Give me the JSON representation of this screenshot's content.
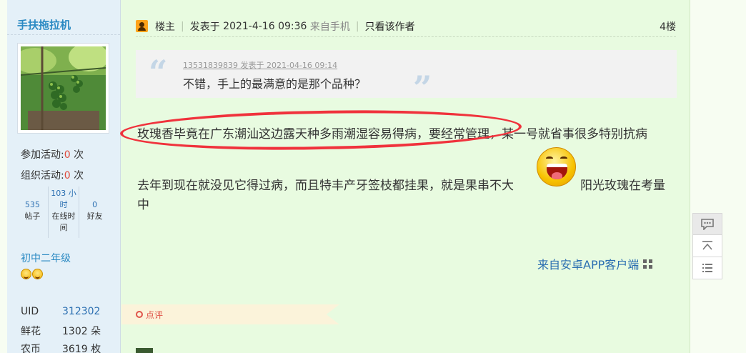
{
  "user": {
    "name": "手扶拖拉机",
    "activities": [
      {
        "label": "参加活动:",
        "value": "0",
        "unit": "次"
      },
      {
        "label": "组织活动:",
        "value": "0",
        "unit": "次"
      }
    ],
    "stats": [
      {
        "value": "535",
        "label": "帖子"
      },
      {
        "value": "103 小时",
        "label": "在线时间"
      },
      {
        "value": "0",
        "label": "好友"
      }
    ],
    "level": "初中二年级",
    "info": [
      {
        "key": "UID",
        "value": "312302"
      },
      {
        "key": "鲜花",
        "value": "1302 朵"
      },
      {
        "key": "农币",
        "value": "3619 枚"
      }
    ]
  },
  "post": {
    "role": "楼主",
    "posted_prefix": "发表于",
    "posted_at": "2021-4-16 09:36",
    "source": "来自手机",
    "only_author": "只看该作者",
    "floor": "4楼",
    "quote": {
      "meta": "13531839839 发表于 2021-04-16 09:14",
      "text": "不错，手上的最满意的是那个品种？"
    },
    "line1": "玫瑰香毕竟在广东潮汕这边露天种多雨潮湿容易得病，要经常管理，某一号就省事很多特别抗病",
    "line2": "去年到现在就没见它得过病，而且特丰产牙签枝都挂果，就是果串不大",
    "line2_after": "阳光玫瑰在考量",
    "line3": "中",
    "client": "来自安卓APP客户端",
    "comment": "点评"
  },
  "colors": {
    "accent_blue": "#2b8ac3",
    "link_blue": "#2b6fb1",
    "highlight_red": "#f0323c",
    "post_bg": "#e8fbe0"
  }
}
